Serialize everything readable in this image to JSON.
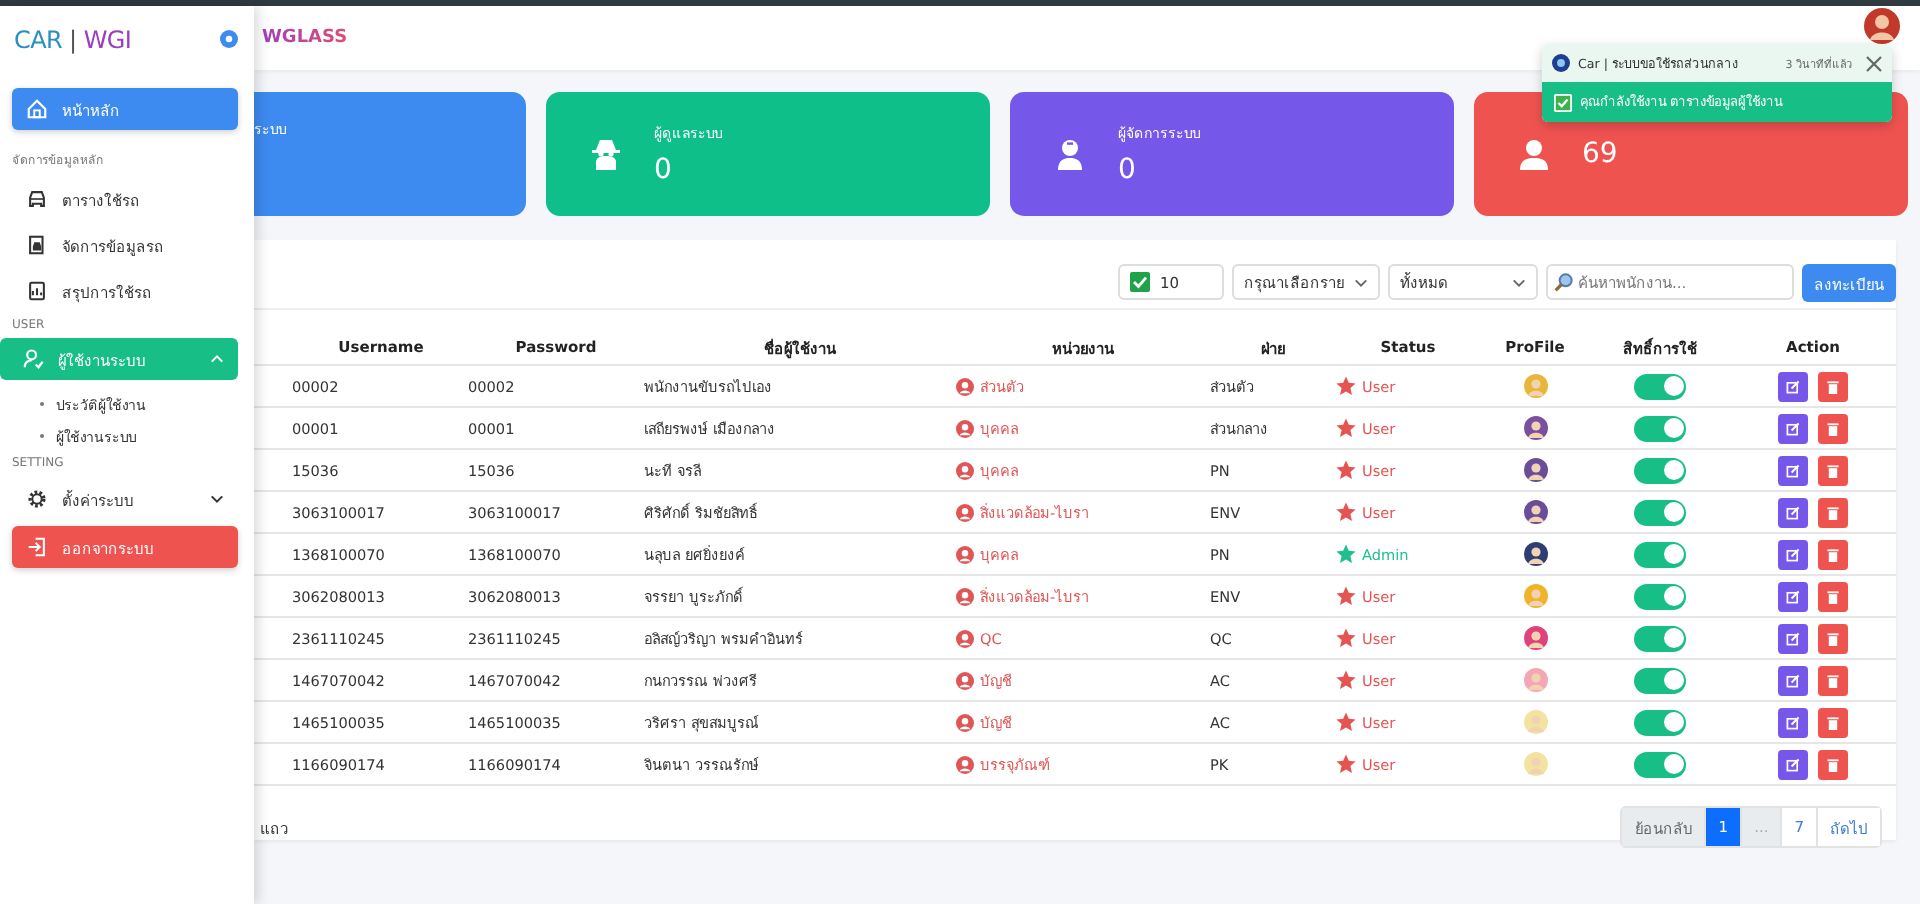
{
  "sidebar": {
    "brand_left": "CAR",
    "brand_separator": "|",
    "brand_right": "WGI",
    "items": [
      {
        "kind": "link",
        "label": "หน้าหลัก",
        "selected": true
      },
      {
        "kind": "section",
        "label": "จัดการข้อมูลหลัก"
      },
      {
        "kind": "link",
        "label": "ตารางใช้รถ",
        "selected": false
      },
      {
        "kind": "link",
        "label": "จัดการข้อมูลรถ",
        "selected": false
      },
      {
        "kind": "link",
        "label": "สรุปการใช้รถ",
        "selected": false
      },
      {
        "kind": "section",
        "label": "USER"
      },
      {
        "kind": "group",
        "label": "ผู้ใช้งานระบบ",
        "selected": true,
        "expanded": true,
        "children": [
          {
            "label": "ประวัติผู้ใช้งาน"
          },
          {
            "label": "ผู้ใช้งานระบบ"
          }
        ]
      },
      {
        "kind": "section",
        "label": "SETTING"
      },
      {
        "kind": "group",
        "label": "ตั้งค่าระบบ",
        "selected": false,
        "expanded": false
      },
      {
        "kind": "logout",
        "label": "ออกจากระบบ"
      }
    ]
  },
  "header": {
    "title": "WGLASS"
  },
  "cards": [
    {
      "label": "ระบบ",
      "color": "#3d8af0"
    },
    {
      "label": "ผู้ดูแลระบบ",
      "value": "0",
      "color": "#0fbf8a"
    },
    {
      "label": "ผู้จัดการระบบ",
      "value": "0",
      "color": "#7558ea"
    },
    {
      "value": "69",
      "color": "#ef5350"
    }
  ],
  "toolbar": {
    "page_size": "10",
    "filter": "กรุณาเลือกราย",
    "scope": "ทั้งหมด",
    "search_placeholder": "ค้นหาพนักงาน...",
    "register_button": "ลงทะเบียน"
  },
  "table": {
    "columns": [
      "Username",
      "Password",
      "ชื่อผู้ใช้งาน",
      "หน่วยงาน",
      "ฝ่าย",
      "Status",
      "ProFile",
      "สิทธิ์การใช้",
      "Action"
    ],
    "rows": [
      {
        "username": "00002",
        "password": "00002",
        "name": "พนักงานขับรถไปเอง",
        "unit": "ส่วนตัว",
        "division": "ส่วนตัว",
        "status": "User",
        "kind": "user",
        "access_on": true
      },
      {
        "username": "00001",
        "password": "00001",
        "name": "เสถียรพงษ์ เมืองกลาง",
        "unit": "บุคคล",
        "division": "ส่วนกลาง",
        "status": "User",
        "kind": "user",
        "access_on": true
      },
      {
        "username": "15036",
        "password": "15036",
        "name": "นะที จรลี",
        "unit": "บุคคล",
        "division": "PN",
        "status": "User",
        "kind": "user",
        "access_on": true
      },
      {
        "username": "3063100017",
        "password": "3063100017",
        "name": "ศิริศักดิ์ ริมชัยสิทธิ์",
        "unit": "สิ่งแวดล้อม-ไบรา",
        "division": "ENV",
        "status": "User",
        "kind": "user",
        "access_on": true
      },
      {
        "username": "1368100070",
        "password": "1368100070",
        "name": "นลุบล ยศยิ่งยงค์",
        "unit": "บุคคล",
        "division": "PN",
        "status": "Admin",
        "kind": "admin",
        "access_on": true
      },
      {
        "username": "3062080013",
        "password": "3062080013",
        "name": "จรรยา บูระภักดิ์",
        "unit": "สิ่งแวดล้อม-ไบรา",
        "division": "ENV",
        "status": "User",
        "kind": "user",
        "access_on": true
      },
      {
        "username": "2361110245",
        "password": "2361110245",
        "name": "อลิสญ์วริญา พรมคำอินทร์",
        "unit": "QC",
        "division": "QC",
        "status": "User",
        "kind": "user",
        "access_on": true
      },
      {
        "username": "1467070042",
        "password": "1467070042",
        "name": "กนกวรรณ พ่วงศรี",
        "unit": "บัญชี",
        "division": "AC",
        "status": "User",
        "kind": "user",
        "access_on": true
      },
      {
        "username": "1465100035",
        "password": "1465100035",
        "name": "วริศรา สุขสมบูรณ์",
        "unit": "บัญชี",
        "division": "AC",
        "status": "User",
        "kind": "user",
        "access_on": true
      },
      {
        "username": "1166090174",
        "password": "1166090174",
        "name": "จินตนา วรรณรักษ์",
        "unit": "บรรจุภัณฑ์",
        "division": "PK",
        "status": "User",
        "kind": "user",
        "access_on": true
      }
    ]
  },
  "footer": {
    "rows_label": "แถว"
  },
  "pagination": [
    {
      "label": "ย้อนกลับ",
      "kind": "prev",
      "disabled": true,
      "selected": false
    },
    {
      "label": "1",
      "kind": "page",
      "disabled": false,
      "selected": true
    },
    {
      "label": "...",
      "kind": "gap",
      "disabled": true,
      "selected": false
    },
    {
      "label": "7",
      "kind": "page",
      "disabled": false,
      "selected": false
    },
    {
      "label": "ถัดไป",
      "kind": "next",
      "disabled": false,
      "selected": false
    }
  ],
  "toast": {
    "title": "Car | ระบบขอใช้รถส่วนกลาง",
    "time": "3 วินาทีที่แล้ว",
    "message": "คุณกำลังใช้งาน ตารางข้อมูลผู้ใช้งาน"
  }
}
